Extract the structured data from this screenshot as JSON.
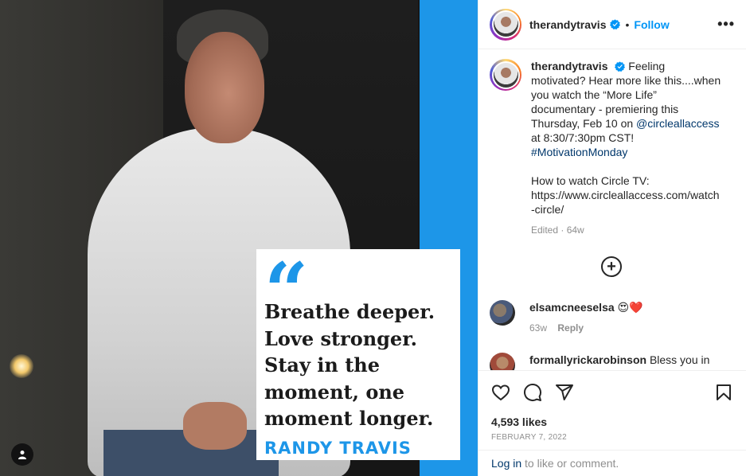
{
  "post": {
    "quote_lines": [
      "Breathe deeper.",
      "Love stronger.",
      "Stay in the",
      "moment, one",
      "moment longer."
    ],
    "quote_author": "RANDY TRAVIS",
    "quote_mark": "“"
  },
  "header": {
    "username": "therandytravis",
    "dot": "•",
    "follow_label": "Follow",
    "more": "•••"
  },
  "caption": {
    "username": "therandytravis",
    "text_1": "Feeling motivated? Hear more like this....when you watch the “More Life” documentary - premiering this Thursday, Feb 10 on",
    "mention": "@circleallaccess",
    "text_2": "at 8:30/7:30pm CST!",
    "hashtag": "#MotivationMonday",
    "text_3": "How to watch Circle TV:",
    "text_4": "https://www.circleallaccess.com/watch-circle/",
    "meta": "Edited · 64w"
  },
  "load_more": "+",
  "comments": [
    {
      "username": "elsamcneeselsa",
      "text": "😍❤️",
      "time": "63w",
      "reply": "Reply"
    },
    {
      "username": "formallyrickarobinson",
      "text": "Bless you in"
    }
  ],
  "likes": "4,593 likes",
  "date": "FEBRUARY 7, 2022",
  "login": {
    "link": "Log in",
    "text": " to like or comment."
  },
  "colors": {
    "accent": "#0095f6",
    "brand_blue": "#1d96e8"
  }
}
